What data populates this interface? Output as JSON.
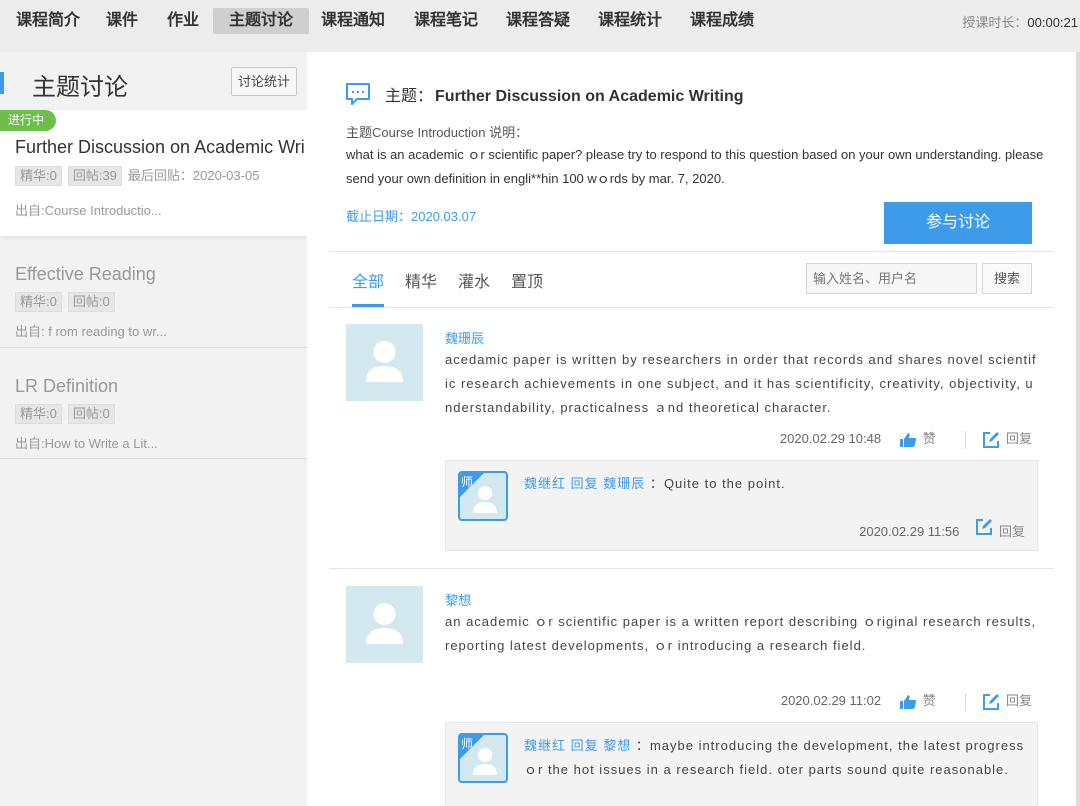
{
  "nav": {
    "tabs": [
      {
        "label": "课程简介"
      },
      {
        "label": "课件"
      },
      {
        "label": "作业"
      },
      {
        "label": "主题讨论"
      },
      {
        "label": "课程通知"
      },
      {
        "label": "课程笔记"
      },
      {
        "label": "课程答疑"
      },
      {
        "label": "课程统计"
      },
      {
        "label": "课程成绩"
      }
    ],
    "timer_label": "授课时长：",
    "timer_value": "00:00:21"
  },
  "sidebar": {
    "title": "主题讨论",
    "stats_button": "讨论统计",
    "topics": [
      {
        "status": "进行中",
        "title": "Further Discussion on Academic Writing",
        "featured": "精华:0",
        "replies": "回帖:39",
        "last_reply": "最后回贴：2020-03-05",
        "source": "出自:Course Introductio..."
      },
      {
        "title": "Effective Reading",
        "featured": "精华:0",
        "replies": "回帖:0",
        "source": "出自: f rom reading to wr..."
      },
      {
        "title": "LR Definition",
        "featured": "精华:0",
        "replies": "回帖:0",
        "source": "出自:How to Write a Lit..."
      }
    ]
  },
  "topic": {
    "title_label": "主题：",
    "title": "Further Discussion on Academic Writing",
    "intro_line": "主题Course Introduction 说明：",
    "description": "what is an academic ｏr scientific paper? please try to respond to this question based on your own understanding. please send your own definition in engli**hin 100 wｏrds by mar. 7, 2020.",
    "deadline": "截止日期：2020.03.07",
    "join_button": "参与讨论"
  },
  "filters": {
    "tabs": [
      {
        "label": "全部"
      },
      {
        "label": "精华"
      },
      {
        "label": "灌水"
      },
      {
        "label": "置顶"
      }
    ],
    "search_placeholder": "输入姓名、用户名",
    "search_button": "搜索"
  },
  "posts": [
    {
      "author": "魏珊辰",
      "body": "acedamic paper is written by researchers in order that records and shares novel scientific research achievements in one subject, and it has scientificity, creativity, objectivity, understandability, practicalness ａnd theoretical character.",
      "time": "2020.02.29 10:48",
      "like": "赞",
      "reply": "回复",
      "replies": [
        {
          "tag": "师",
          "author": "魏继红",
          "verb": "回复",
          "target": "魏珊辰",
          "colon": "：",
          "text": "Quite to the point.",
          "time": "2020.02.29 11:56",
          "reply": "回复"
        }
      ]
    },
    {
      "author": "黎想",
      "body": "an academic ｏr scientific paper is a written report describing ｏriginal research results, reporting latest developments, ｏr introducing a research field.",
      "time": "2020.02.29 11:02",
      "like": "赞",
      "reply": "回复",
      "replies": [
        {
          "tag": "师",
          "author": "魏继红",
          "verb": "回复",
          "target": "黎想",
          "colon": "：",
          "text": "maybe introducing the development, the latest progress ｏr the hot issues in a research field. oter parts sound quite reasonable."
        }
      ]
    }
  ],
  "colors": {
    "accent": "#3d9be9",
    "status_green": "#6cc04a",
    "avatar_bg": "#d4e8f0"
  }
}
